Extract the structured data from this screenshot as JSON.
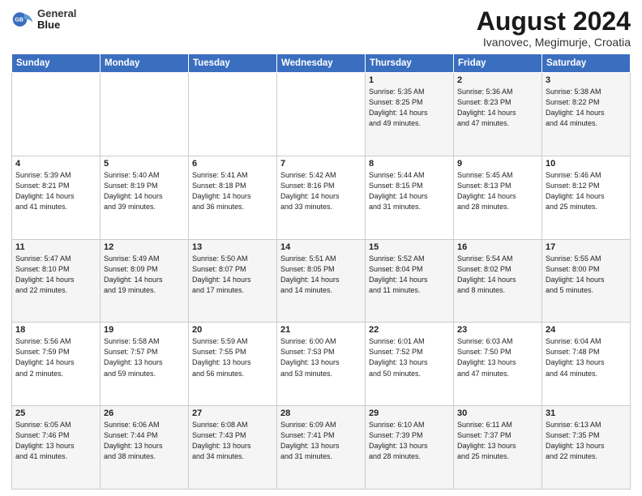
{
  "header": {
    "logo_line1": "General",
    "logo_line2": "Blue",
    "title": "August 2024",
    "subtitle": "Ivanovec, Megimurje, Croatia"
  },
  "weekdays": [
    "Sunday",
    "Monday",
    "Tuesday",
    "Wednesday",
    "Thursday",
    "Friday",
    "Saturday"
  ],
  "weeks": [
    [
      {
        "day": "",
        "info": ""
      },
      {
        "day": "",
        "info": ""
      },
      {
        "day": "",
        "info": ""
      },
      {
        "day": "",
        "info": ""
      },
      {
        "day": "1",
        "info": "Sunrise: 5:35 AM\nSunset: 8:25 PM\nDaylight: 14 hours\nand 49 minutes."
      },
      {
        "day": "2",
        "info": "Sunrise: 5:36 AM\nSunset: 8:23 PM\nDaylight: 14 hours\nand 47 minutes."
      },
      {
        "day": "3",
        "info": "Sunrise: 5:38 AM\nSunset: 8:22 PM\nDaylight: 14 hours\nand 44 minutes."
      }
    ],
    [
      {
        "day": "4",
        "info": "Sunrise: 5:39 AM\nSunset: 8:21 PM\nDaylight: 14 hours\nand 41 minutes."
      },
      {
        "day": "5",
        "info": "Sunrise: 5:40 AM\nSunset: 8:19 PM\nDaylight: 14 hours\nand 39 minutes."
      },
      {
        "day": "6",
        "info": "Sunrise: 5:41 AM\nSunset: 8:18 PM\nDaylight: 14 hours\nand 36 minutes."
      },
      {
        "day": "7",
        "info": "Sunrise: 5:42 AM\nSunset: 8:16 PM\nDaylight: 14 hours\nand 33 minutes."
      },
      {
        "day": "8",
        "info": "Sunrise: 5:44 AM\nSunset: 8:15 PM\nDaylight: 14 hours\nand 31 minutes."
      },
      {
        "day": "9",
        "info": "Sunrise: 5:45 AM\nSunset: 8:13 PM\nDaylight: 14 hours\nand 28 minutes."
      },
      {
        "day": "10",
        "info": "Sunrise: 5:46 AM\nSunset: 8:12 PM\nDaylight: 14 hours\nand 25 minutes."
      }
    ],
    [
      {
        "day": "11",
        "info": "Sunrise: 5:47 AM\nSunset: 8:10 PM\nDaylight: 14 hours\nand 22 minutes."
      },
      {
        "day": "12",
        "info": "Sunrise: 5:49 AM\nSunset: 8:09 PM\nDaylight: 14 hours\nand 19 minutes."
      },
      {
        "day": "13",
        "info": "Sunrise: 5:50 AM\nSunset: 8:07 PM\nDaylight: 14 hours\nand 17 minutes."
      },
      {
        "day": "14",
        "info": "Sunrise: 5:51 AM\nSunset: 8:05 PM\nDaylight: 14 hours\nand 14 minutes."
      },
      {
        "day": "15",
        "info": "Sunrise: 5:52 AM\nSunset: 8:04 PM\nDaylight: 14 hours\nand 11 minutes."
      },
      {
        "day": "16",
        "info": "Sunrise: 5:54 AM\nSunset: 8:02 PM\nDaylight: 14 hours\nand 8 minutes."
      },
      {
        "day": "17",
        "info": "Sunrise: 5:55 AM\nSunset: 8:00 PM\nDaylight: 14 hours\nand 5 minutes."
      }
    ],
    [
      {
        "day": "18",
        "info": "Sunrise: 5:56 AM\nSunset: 7:59 PM\nDaylight: 14 hours\nand 2 minutes."
      },
      {
        "day": "19",
        "info": "Sunrise: 5:58 AM\nSunset: 7:57 PM\nDaylight: 13 hours\nand 59 minutes."
      },
      {
        "day": "20",
        "info": "Sunrise: 5:59 AM\nSunset: 7:55 PM\nDaylight: 13 hours\nand 56 minutes."
      },
      {
        "day": "21",
        "info": "Sunrise: 6:00 AM\nSunset: 7:53 PM\nDaylight: 13 hours\nand 53 minutes."
      },
      {
        "day": "22",
        "info": "Sunrise: 6:01 AM\nSunset: 7:52 PM\nDaylight: 13 hours\nand 50 minutes."
      },
      {
        "day": "23",
        "info": "Sunrise: 6:03 AM\nSunset: 7:50 PM\nDaylight: 13 hours\nand 47 minutes."
      },
      {
        "day": "24",
        "info": "Sunrise: 6:04 AM\nSunset: 7:48 PM\nDaylight: 13 hours\nand 44 minutes."
      }
    ],
    [
      {
        "day": "25",
        "info": "Sunrise: 6:05 AM\nSunset: 7:46 PM\nDaylight: 13 hours\nand 41 minutes."
      },
      {
        "day": "26",
        "info": "Sunrise: 6:06 AM\nSunset: 7:44 PM\nDaylight: 13 hours\nand 38 minutes."
      },
      {
        "day": "27",
        "info": "Sunrise: 6:08 AM\nSunset: 7:43 PM\nDaylight: 13 hours\nand 34 minutes."
      },
      {
        "day": "28",
        "info": "Sunrise: 6:09 AM\nSunset: 7:41 PM\nDaylight: 13 hours\nand 31 minutes."
      },
      {
        "day": "29",
        "info": "Sunrise: 6:10 AM\nSunset: 7:39 PM\nDaylight: 13 hours\nand 28 minutes."
      },
      {
        "day": "30",
        "info": "Sunrise: 6:11 AM\nSunset: 7:37 PM\nDaylight: 13 hours\nand 25 minutes."
      },
      {
        "day": "31",
        "info": "Sunrise: 6:13 AM\nSunset: 7:35 PM\nDaylight: 13 hours\nand 22 minutes."
      }
    ]
  ]
}
